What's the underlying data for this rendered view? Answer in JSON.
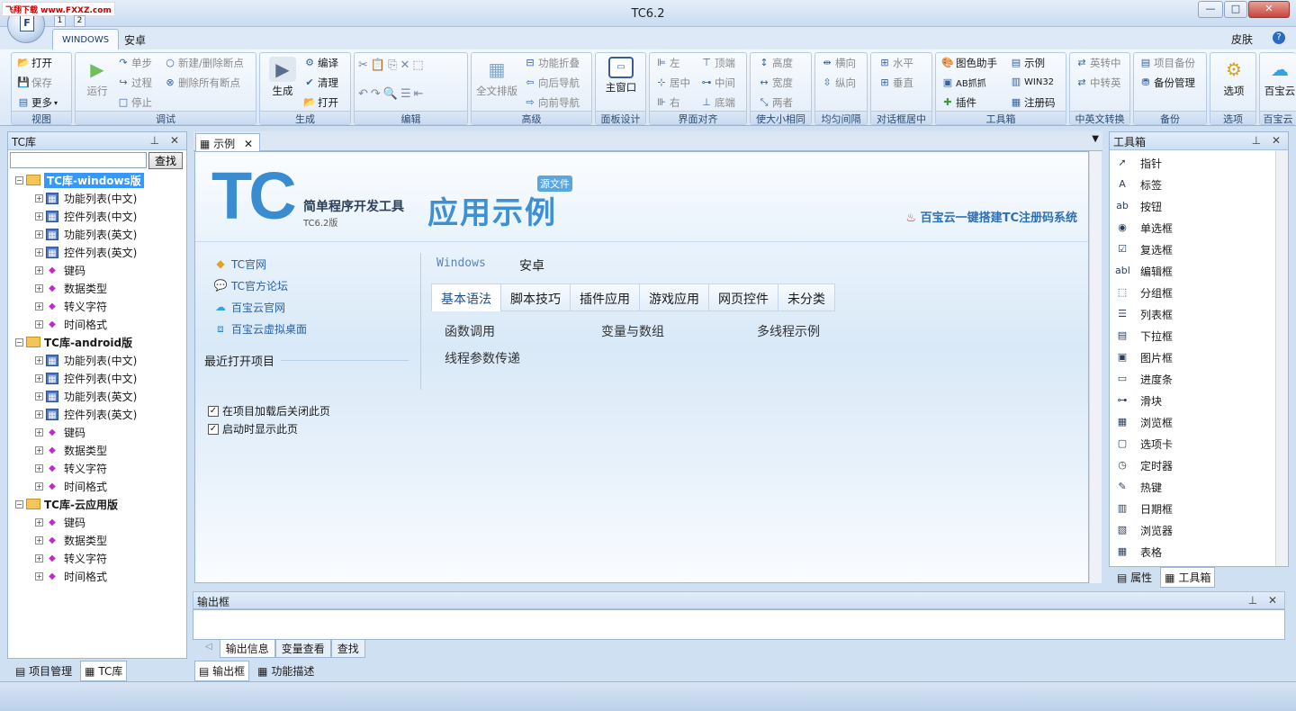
{
  "window": {
    "title": "TC6.2",
    "minimize": "—",
    "maximize": "□",
    "close": "✕"
  },
  "app_button": {
    "label": "F"
  },
  "watermark": "飞翔下载 www.FXXZ.com",
  "quick_access": {
    "item1": "1",
    "item2": "2"
  },
  "menu_tabs": [
    {
      "label": "WINDOWS"
    },
    {
      "label": "安卓"
    }
  ],
  "skin": {
    "label": "皮肤",
    "help": "?"
  },
  "ribbon": {
    "view": {
      "label": "视图",
      "open": "打开",
      "save": "保存",
      "more": "更多"
    },
    "debug": {
      "label": "调试",
      "run": "运行",
      "step": "单步",
      "process": "过程",
      "stop": "停止",
      "new_bp": "新建/删除断点",
      "del_bp": "删除所有断点"
    },
    "build": {
      "label": "生成",
      "build": "生成",
      "compile": "编译",
      "clean": "清理",
      "open": "打开"
    },
    "edit": {
      "label": "编辑"
    },
    "advanced": {
      "label": "高级",
      "fulltext": "全文排版",
      "fold": "功能折叠",
      "navfwd": "向后导航",
      "navback": "向前导航"
    },
    "panel": {
      "label": "面板设计",
      "main": "主窗口"
    },
    "align": {
      "label": "界面对齐",
      "left": "左",
      "center": "居中",
      "right": "右",
      "top": "顶端",
      "middle": "中间",
      "bottom": "底端"
    },
    "size": {
      "label": "使大小相同",
      "height": "高度",
      "width": "宽度",
      "both": "两者"
    },
    "spacing": {
      "label": "均匀间隔",
      "horizontal": "横向",
      "vertical": "纵向"
    },
    "dialog": {
      "label": "对话框居中",
      "horizontal": "水平",
      "vertical": "垂直"
    },
    "toolbox": {
      "label": "工具箱",
      "color": "图色助手",
      "capture": "AB抓抓",
      "plugin": "插件",
      "example": "示例",
      "win32": "WIN32",
      "regcode": "注册码"
    },
    "convert": {
      "label": "中英文转换",
      "en2cn": "英转中",
      "cn2en": "中转英"
    },
    "backup": {
      "label": "备份",
      "project": "项目备份",
      "manage": "备份管理"
    },
    "options": {
      "label": "选项",
      "btn": "选项"
    },
    "baibao": {
      "label": "百宝云",
      "btn": "百宝云"
    }
  },
  "left_panel": {
    "title": "TC库",
    "search_button": "查找",
    "search_value": "",
    "tree": [
      {
        "label": "TC库-windows版",
        "level": 0,
        "selected": true
      },
      {
        "label": "功能列表(中文)",
        "level": 1,
        "icon": "table"
      },
      {
        "label": "控件列表(中文)",
        "level": 1,
        "icon": "table"
      },
      {
        "label": "功能列表(英文)",
        "level": 1,
        "icon": "table"
      },
      {
        "label": "控件列表(英文)",
        "level": 1,
        "icon": "table"
      },
      {
        "label": "键码",
        "level": 1,
        "icon": "diamond"
      },
      {
        "label": "数据类型",
        "level": 1,
        "icon": "diamond"
      },
      {
        "label": "转义字符",
        "level": 1,
        "icon": "diamond"
      },
      {
        "label": "时间格式",
        "level": 1,
        "icon": "diamond"
      },
      {
        "label": "TC库-android版",
        "level": 0
      },
      {
        "label": "功能列表(中文)",
        "level": 1,
        "icon": "table"
      },
      {
        "label": "控件列表(中文)",
        "level": 1,
        "icon": "table"
      },
      {
        "label": "功能列表(英文)",
        "level": 1,
        "icon": "table"
      },
      {
        "label": "控件列表(英文)",
        "level": 1,
        "icon": "table"
      },
      {
        "label": "键码",
        "level": 1,
        "icon": "diamond"
      },
      {
        "label": "数据类型",
        "level": 1,
        "icon": "diamond"
      },
      {
        "label": "转义字符",
        "level": 1,
        "icon": "diamond"
      },
      {
        "label": "时间格式",
        "level": 1,
        "icon": "diamond"
      },
      {
        "label": "TC库-云应用版",
        "level": 0
      },
      {
        "label": "键码",
        "level": 1,
        "icon": "diamond"
      },
      {
        "label": "数据类型",
        "level": 1,
        "icon": "diamond"
      },
      {
        "label": "转义字符",
        "level": 1,
        "icon": "diamond"
      },
      {
        "label": "时间格式",
        "level": 1,
        "icon": "diamond"
      }
    ],
    "tabs": [
      {
        "label": "项目管理"
      },
      {
        "label": "TC库"
      }
    ]
  },
  "doc_tab": {
    "label": "示例"
  },
  "start_page": {
    "logo": "TC",
    "subtitle": "简单程序开发工具",
    "version": "TC6.2版",
    "heading": "应用示例",
    "badge": "源文件",
    "promo": "百宝云一键搭建TC注册码系统",
    "links": [
      "TC官网",
      "TC官方论坛",
      "百宝云官网",
      "百宝云虚拟桌面"
    ],
    "recent": "最近打开项目",
    "checkbox1": "在项目加载后关闭此页",
    "checkbox2": "启动时显示此页",
    "platform_win": "Windows",
    "platform_android": "安卓",
    "tabs": [
      "基本语法",
      "脚本技巧",
      "插件应用",
      "游戏应用",
      "网页控件",
      "未分类"
    ],
    "items": [
      "函数调用",
      "变量与数组",
      "多线程示例",
      "线程参数传递"
    ]
  },
  "output": {
    "title": "输出框",
    "tabs": [
      "输出信息",
      "变量查看",
      "查找"
    ],
    "bottom_tabs": [
      {
        "label": "输出框"
      },
      {
        "label": "功能描述"
      }
    ]
  },
  "toolbox": {
    "title": "工具箱",
    "items": [
      {
        "label": "指针",
        "icon": "pointer-icon",
        "glyph": "➚"
      },
      {
        "label": "标签",
        "icon": "label-icon",
        "glyph": "A"
      },
      {
        "label": "按钮",
        "icon": "button-icon",
        "glyph": "ab"
      },
      {
        "label": "单选框",
        "icon": "radio-icon",
        "glyph": "◉"
      },
      {
        "label": "复选框",
        "icon": "checkbox-icon",
        "glyph": "☑"
      },
      {
        "label": "编辑框",
        "icon": "editbox-icon",
        "glyph": "abl"
      },
      {
        "label": "分组框",
        "icon": "groupbox-icon",
        "glyph": "⬚"
      },
      {
        "label": "列表框",
        "icon": "listbox-icon",
        "glyph": "☰"
      },
      {
        "label": "下拉框",
        "icon": "combobox-icon",
        "glyph": "▤"
      },
      {
        "label": "图片框",
        "icon": "picture-icon",
        "glyph": "▣"
      },
      {
        "label": "进度条",
        "icon": "progress-icon",
        "glyph": "▭"
      },
      {
        "label": "滑块",
        "icon": "slider-icon",
        "glyph": "⊶"
      },
      {
        "label": "浏览框",
        "icon": "browse-icon",
        "glyph": "▦"
      },
      {
        "label": "选项卡",
        "icon": "tab-icon",
        "glyph": "▢"
      },
      {
        "label": "定时器",
        "icon": "timer-icon",
        "glyph": "◷"
      },
      {
        "label": "热键",
        "icon": "hotkey-icon",
        "glyph": "✎"
      },
      {
        "label": "日期框",
        "icon": "date-icon",
        "glyph": "▥"
      },
      {
        "label": "浏览器",
        "icon": "browser-icon",
        "glyph": "▧"
      },
      {
        "label": "表格",
        "icon": "grid-icon",
        "glyph": "▦"
      }
    ],
    "tabs": [
      {
        "label": "属性"
      },
      {
        "label": "工具箱"
      }
    ]
  }
}
